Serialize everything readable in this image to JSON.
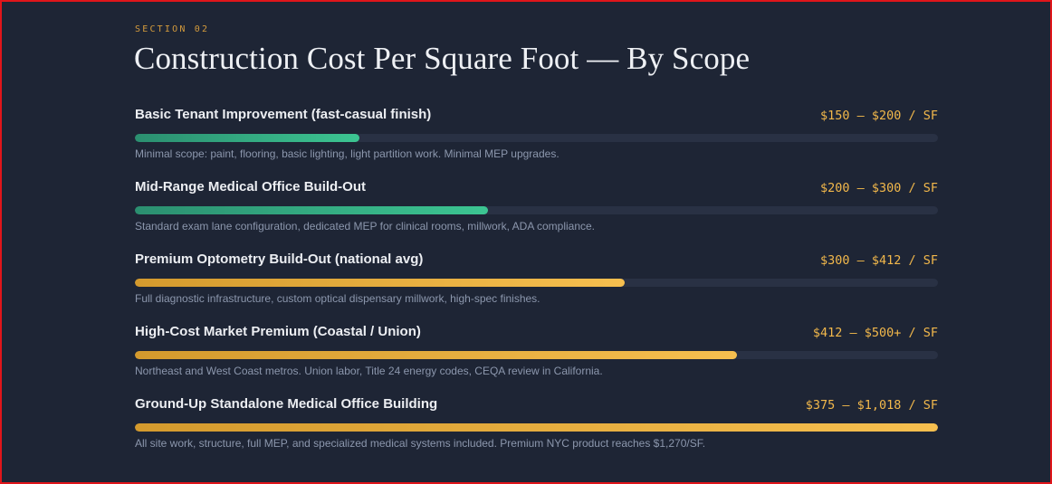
{
  "section": {
    "eyebrow": "SECTION 02",
    "title": "Construction Cost Per Square Foot — By Scope"
  },
  "rows": [
    {
      "label": "Basic Tenant Improvement (fast-casual finish)",
      "price": "$150 – $200 / SF",
      "level": 0.28,
      "color": "green",
      "description": "Minimal scope: paint, flooring, basic lighting, light partition work. Minimal MEP upgrades."
    },
    {
      "label": "Mid-Range Medical Office Build-Out",
      "price": "$200 – $300 / SF",
      "level": 0.44,
      "color": "green",
      "description": "Standard exam lane configuration, dedicated MEP for clinical rooms, millwork, ADA compliance."
    },
    {
      "label": "Premium Optometry Build-Out (national avg)",
      "price": "$300 – $412 / SF",
      "level": 0.61,
      "color": "gold",
      "description": "Full diagnostic infrastructure, custom optical dispensary millwork, high-spec finishes."
    },
    {
      "label": "High-Cost Market Premium (Coastal / Union)",
      "price": "$412 – $500+ / SF",
      "level": 0.75,
      "color": "gold",
      "description": "Northeast and West Coast metros. Union labor, Title 24 energy codes, CEQA review in California."
    },
    {
      "label": "Ground-Up Standalone Medical Office Building",
      "price": "$375 – $1,018 / SF",
      "level": 1.0,
      "color": "gold",
      "description": "All site work, structure, full MEP, and specialized medical systems included. Premium NYC product reaches $1,270/SF."
    }
  ]
}
